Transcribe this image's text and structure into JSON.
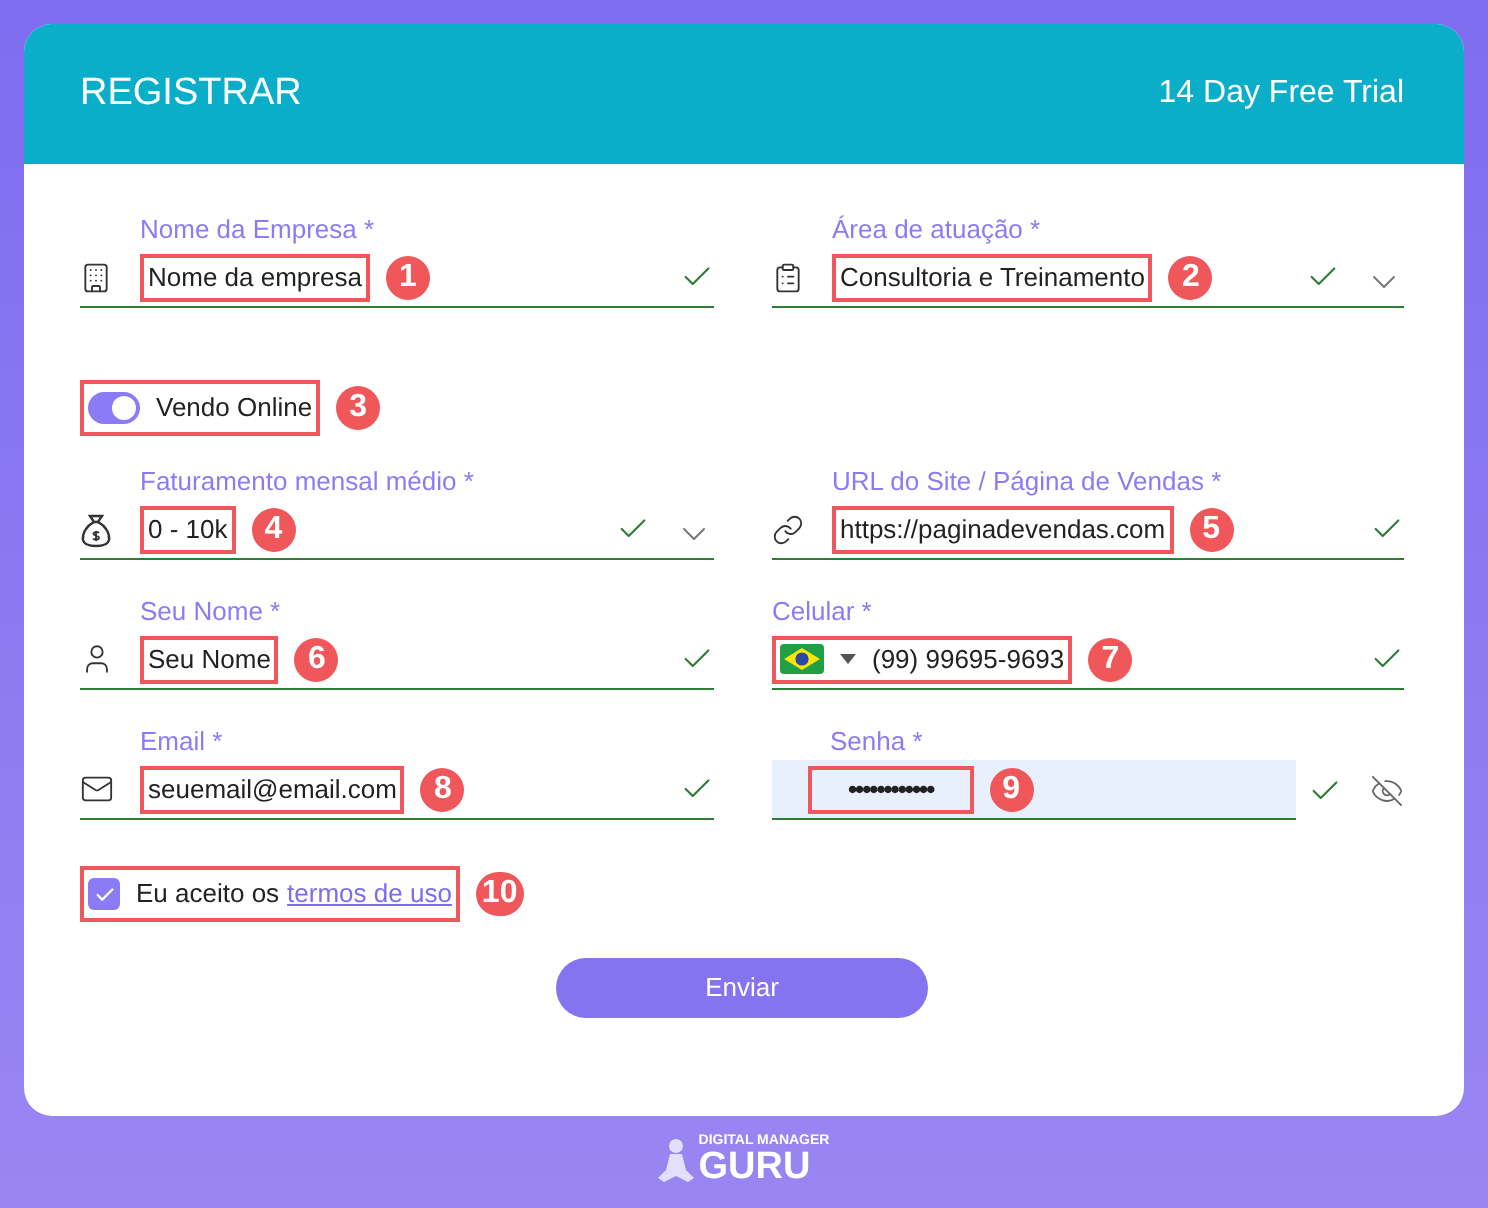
{
  "header": {
    "title": "REGISTRAR",
    "trial": "14 Day Free Trial"
  },
  "rows": [
    {
      "kind": "pair",
      "fields": [
        {
          "kind": "company",
          "label": "Nome da Empresa *",
          "value": "Nome da empresa",
          "valid": true,
          "callout": "1"
        },
        {
          "kind": "sector",
          "label": "Área de atuação *",
          "value": "Consultoria e Treinamento",
          "valid": true,
          "callout": "2"
        }
      ]
    },
    {
      "kind": "toggle",
      "label": "Vendo Online",
      "on": true,
      "callout": "3"
    },
    {
      "kind": "pair",
      "fields": [
        {
          "kind": "revenue",
          "label": "Faturamento mensal médio *",
          "value": "0 - 10k",
          "valid": true,
          "callout": "4"
        },
        {
          "kind": "url",
          "label": "URL do Site / Página de Vendas *",
          "value": "https://paginadevendas.com",
          "valid": true,
          "callout": "5"
        }
      ]
    },
    {
      "kind": "pair",
      "fields": [
        {
          "kind": "name",
          "label": "Seu Nome *",
          "value": "Seu Nome",
          "valid": true,
          "callout": "6"
        },
        {
          "kind": "phone",
          "label": "Celular *",
          "value": "(99) 99695-9693",
          "valid": true,
          "callout": "7"
        }
      ]
    },
    {
      "kind": "pair",
      "fields": [
        {
          "kind": "email",
          "label": "Email *",
          "value": "seuemail@email.com",
          "valid": true,
          "callout": "8"
        },
        {
          "kind": "password",
          "label": "Senha *",
          "value": "••••••••••••",
          "valid": true,
          "callout": "9"
        }
      ]
    },
    {
      "kind": "terms",
      "text": "Eu aceito os",
      "link": "termos de uso",
      "checked": true,
      "callout": "10"
    }
  ],
  "submit": "Enviar",
  "logo": {
    "small": "DIGITAL MANAGER",
    "big": "GURU"
  }
}
